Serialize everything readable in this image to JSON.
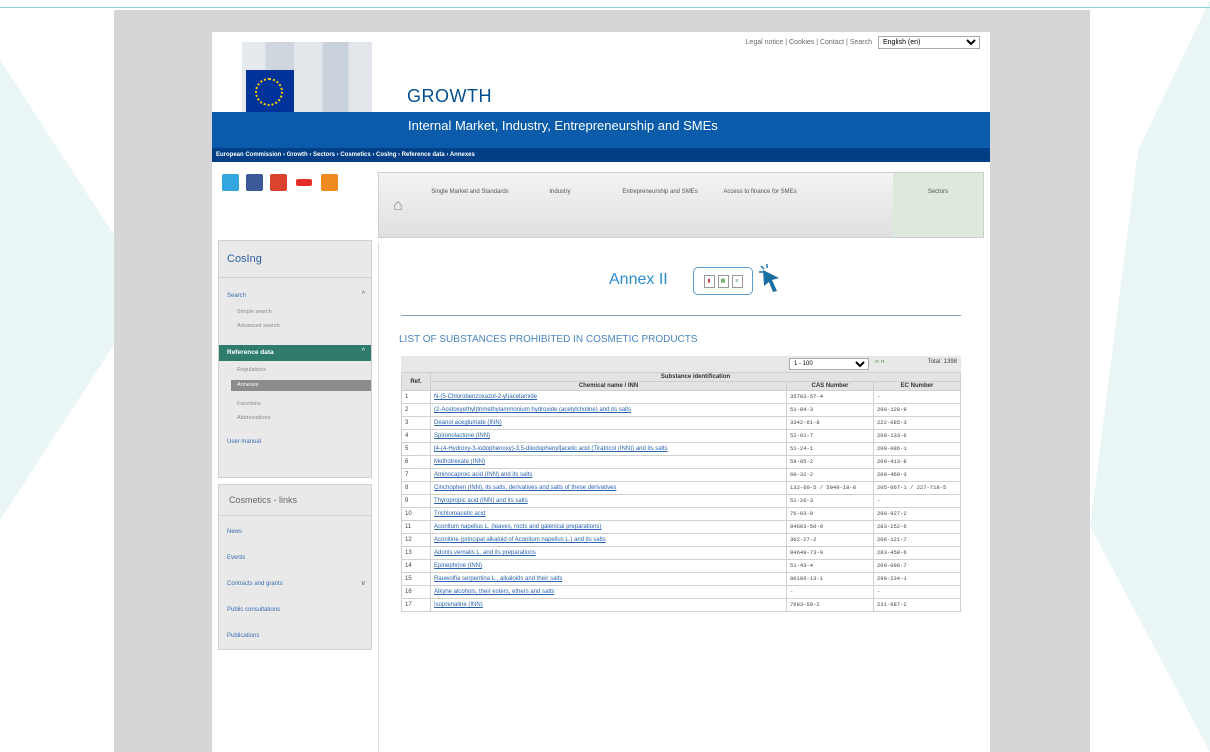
{
  "util": {
    "links": "Legal notice | Cookies | Contact | Search",
    "language": "English (en)"
  },
  "header": {
    "logo_caption": "European Commission",
    "title": "GROWTH",
    "subtitle": "Internal Market, Industry, Entrepreneurship and SMEs",
    "breadcrumb": "European Commission › Growth › Sectors › Cosmetics › CosIng › Reference data › Annexes"
  },
  "nav": {
    "items": [
      "Single Market and Standards",
      "Industry",
      "Entrepreneurship and SMEs",
      "Access to finance for SMEs",
      "Sectors"
    ]
  },
  "sidebar": {
    "title": "CosIng",
    "search": "Search",
    "simple_search": "Simple search",
    "advanced_search": "Advanced search",
    "reference_data": "Reference data",
    "regulations": "Regulations",
    "annexes": "Annexes",
    "functions": "Functions",
    "abbreviations": "Abbreviations",
    "user_manual": "User manual"
  },
  "sidebar2": {
    "title": "Cosmetics - links",
    "items": [
      "News",
      "Events",
      "Contracts and grants",
      "Public consultations",
      "Publications"
    ]
  },
  "content": {
    "annex_title": "Annex II",
    "list_title": "LIST OF SUBSTANCES PROHIBITED IN COSMETIC PRODUCTS",
    "range": "1 - 100",
    "total": "Total: 1398"
  },
  "table": {
    "group_header": "Substance identification",
    "ref_header": "Ref.",
    "name_header": "Chemical name / INN",
    "cas_header": "CAS Number",
    "ec_header": "EC Number",
    "rows": [
      {
        "ref": "1",
        "name": "N-(5-Chlorobenzoxazol-2-yl)acetamide",
        "cas": "35783-57-4",
        "ec": "-"
      },
      {
        "ref": "2",
        "name": "(2-Acetoxyethyl)trimethylammonium hydroxide (acetylcholine) and its salts",
        "cas": "51-84-3",
        "ec": "200-128-9"
      },
      {
        "ref": "3",
        "name": "Deanol aceglumate (INN)",
        "cas": "3342-61-8",
        "ec": "222-085-3"
      },
      {
        "ref": "4",
        "name": "Spironolactone (INN)",
        "cas": "52-01-7",
        "ec": "200-133-6"
      },
      {
        "ref": "5",
        "name": "[4-(4-Hydroxy-3-iodophenoxy)-3,5-diiodophenyl]acetic acid (Tiratricol (INN)) and its salts",
        "cas": "51-24-1",
        "ec": "200-086-1"
      },
      {
        "ref": "6",
        "name": "Methotrexate (INN)",
        "cas": "59-05-2",
        "ec": "200-413-8"
      },
      {
        "ref": "7",
        "name": "Aminocaproic acid (INN) and its salts",
        "cas": "60-32-2",
        "ec": "200-469-3"
      },
      {
        "ref": "8",
        "name": "Cinchophen (INN), its salts, derivatives and salts of these derivatives",
        "cas": "132-60-5 / 5949-18-8",
        "ec": "205-067-1 / 227-718-5"
      },
      {
        "ref": "9",
        "name": "Thyropropic acid (INN) and its salts",
        "cas": "51-26-3",
        "ec": "-"
      },
      {
        "ref": "10",
        "name": "Trichloroacetic acid",
        "cas": "76-03-9",
        "ec": "200-927-2"
      },
      {
        "ref": "11",
        "name": "Aconitum napellus L. (leaves, roots and galenical preparations)",
        "cas": "84603-50-9",
        "ec": "283-252-6"
      },
      {
        "ref": "12",
        "name": "Aconitine (principal alkaloid of Aconitum napellus L.) and its salts",
        "cas": "302-27-2",
        "ec": "206-121-7"
      },
      {
        "ref": "13",
        "name": "Adonis vernalis L. and its preparations",
        "cas": "84649-73-0",
        "ec": "283-458-6"
      },
      {
        "ref": "14",
        "name": "Epinephrine (INN)",
        "cas": "51-43-4",
        "ec": "200-098-7"
      },
      {
        "ref": "15",
        "name": "Rauwolfia serpentina L., alkaloids and their salts",
        "cas": "90106-13-1",
        "ec": "290-234-1"
      },
      {
        "ref": "16",
        "name": "Alkyne alcohols, their esters, ethers and salts",
        "cas": "-",
        "ec": "-"
      },
      {
        "ref": "17",
        "name": "Isoprenaline (INN)",
        "cas": "7683-59-2",
        "ec": "231-687-2"
      }
    ]
  }
}
